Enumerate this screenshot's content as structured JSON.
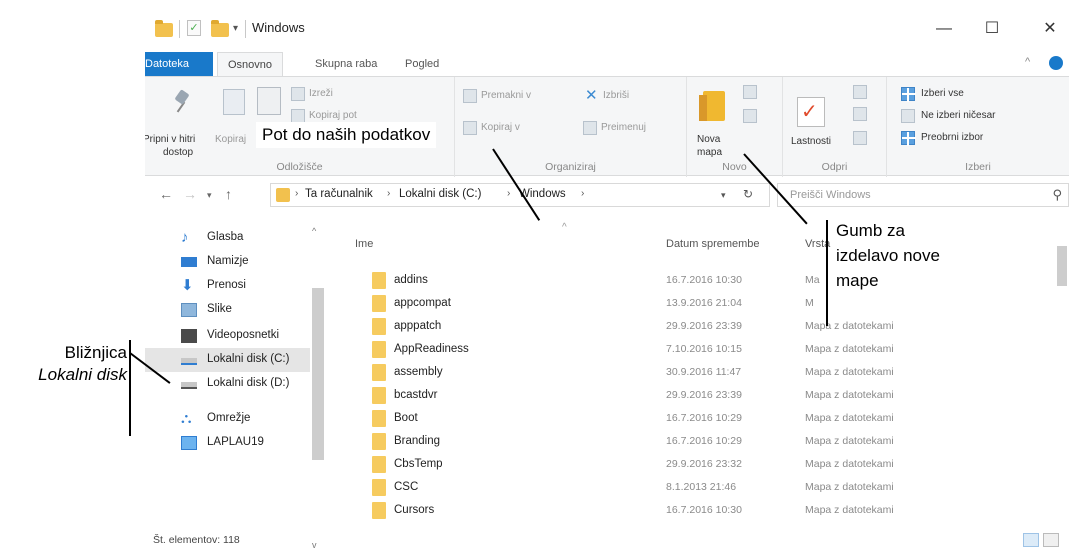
{
  "window": {
    "title": "Windows",
    "tabs": [
      "Datoteka",
      "Osnovno",
      "Skupna raba",
      "Pogled"
    ],
    "controls": {
      "minimize": "—",
      "maximize": "☐",
      "close": "✕"
    }
  },
  "ribbon": {
    "clipboard": {
      "pin": "Pripni v hitri",
      "pin2": "dostop",
      "copy": "Kopiraj",
      "cut": "Izreži",
      "copy_path": "Kopiraj pot",
      "label": "Odložišče"
    },
    "organize": {
      "move": "Premakni v",
      "copy_to": "Kopiraj v",
      "delete": "Izbriši",
      "rename": "Preimenuj",
      "label": "Organiziraj"
    },
    "new": {
      "new_folder": "Nova",
      "new_folder2": "mapa",
      "label": "Novo"
    },
    "open": {
      "properties": "Lastnosti",
      "label": "Odpri"
    },
    "select": {
      "select_all": "Izberi vse",
      "select_none": "Ne izberi ničesar",
      "invert": "Preobrni izbor",
      "label": "Izberi"
    }
  },
  "address": {
    "crumbs": [
      "Ta računalnik",
      "Lokalni disk (C:)",
      "Windows"
    ],
    "search_placeholder": "Preišči Windows"
  },
  "nav_pane": [
    {
      "label": "Glasba",
      "icon": "music-icon"
    },
    {
      "label": "Namizje",
      "icon": "desktop-icon"
    },
    {
      "label": "Prenosi",
      "icon": "downloads-icon"
    },
    {
      "label": "Slike",
      "icon": "pictures-icon"
    },
    {
      "label": "Videoposnetki",
      "icon": "videos-icon"
    },
    {
      "label": "Lokalni disk (C:)",
      "icon": "drive-icon",
      "selected": true
    },
    {
      "label": "Lokalni disk (D:)",
      "icon": "drive-icon"
    },
    {
      "label": "Omrežje",
      "icon": "network-icon"
    },
    {
      "label": "LAPLAU19",
      "icon": "computer-icon"
    }
  ],
  "file_list": {
    "columns": [
      "Ime",
      "Datum spremembe",
      "Vrsta"
    ],
    "rows": [
      {
        "name": "addins",
        "date": "16.7.2016 10:30",
        "type": "Ma"
      },
      {
        "name": "appcompat",
        "date": "13.9.2016 21:04",
        "type": "M"
      },
      {
        "name": "apppatch",
        "date": "29.9.2016 23:39",
        "type": "Mapa z datotekami"
      },
      {
        "name": "AppReadiness",
        "date": "7.10.2016 10:15",
        "type": "Mapa z datotekami"
      },
      {
        "name": "assembly",
        "date": "30.9.2016 11:47",
        "type": "Mapa z datotekami"
      },
      {
        "name": "bcastdvr",
        "date": "29.9.2016 23:39",
        "type": "Mapa z datotekami"
      },
      {
        "name": "Boot",
        "date": "16.7.2016 10:29",
        "type": "Mapa z datotekami"
      },
      {
        "name": "Branding",
        "date": "16.7.2016 10:29",
        "type": "Mapa z datotekami"
      },
      {
        "name": "CbsTemp",
        "date": "29.9.2016 23:32",
        "type": "Mapa z datotekami"
      },
      {
        "name": "CSC",
        "date": "8.1.2013 21:46",
        "type": "Mapa z datotekami"
      },
      {
        "name": "Cursors",
        "date": "16.7.2016 10:30",
        "type": "Mapa z datotekami"
      }
    ]
  },
  "status": {
    "count": "Št. elementov: 118"
  },
  "annotations": {
    "path": "Pot do naših podatkov",
    "new_folder_line1": "Gumb za",
    "new_folder_line2": "izdelavo nove",
    "new_folder_line3": "mape",
    "shortcut_line1": "Bližnjica",
    "shortcut_line2": "Lokalni disk"
  }
}
